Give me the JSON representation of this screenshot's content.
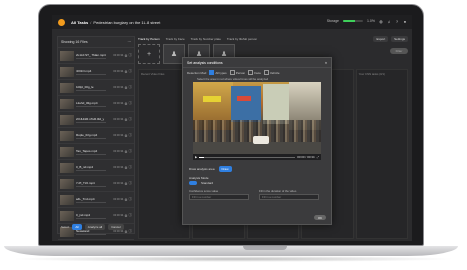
{
  "topbar": {
    "breadcrumb_root": "All Tasks",
    "breadcrumb_sep": "/",
    "task_title": "Pedestrian burglary on the 1L.8 street",
    "storage_label": "Storage",
    "storage_used": "1.0%",
    "storage_fraction": 0.6,
    "right_icons": [
      "globe-icon",
      "bell-icon",
      "help-icon",
      "user-icon"
    ]
  },
  "sidebar": {
    "header": "Showing 16 Files",
    "items": [
      {
        "name": "2L1L0.ST_ 7fdan.mp4",
        "meta": "00:00:34"
      },
      {
        "name": "4Ol1O.mp4",
        "meta": "00:00:34"
      },
      {
        "name": "1i0lpl_0tlg_le",
        "meta": "00:00:34"
      },
      {
        "name": "L2ehd_0tlg.mp4",
        "meta": "00:00:34"
      },
      {
        "name": "2OJHt1R.nTeR.0ld_y",
        "meta": "00:00:34"
      },
      {
        "name": "Ruple_0rlg.mp4",
        "meta": "00:00:34"
      },
      {
        "name": "Tan_Tapos.mp4",
        "meta": "00:00:34"
      },
      {
        "name": "0_B_nd.mp4",
        "meta": "00:00:34"
      },
      {
        "name": "7-Pl_Tz0.mp4",
        "meta": "00:00:34"
      },
      {
        "name": "a4L_Tnd.mp4",
        "meta": "00:00:34"
      },
      {
        "name": "0_jnd.mp4",
        "meta": "00:00:34"
      },
      {
        "name": "Neweland",
        "meta": "00:00:34"
      }
    ],
    "footer": {
      "select_label": "Select",
      "all_label": "All",
      "analyze_label": "Analyze all",
      "cancel_label": "Cancel"
    }
  },
  "main": {
    "tabs": [
      "Track by Person",
      "Track by Face",
      "Track by Number plate",
      "Track by lifeSki person"
    ],
    "export_label": "Export",
    "settings_label": "Settings",
    "analyze_label": "Filter",
    "columns": [
      "Recent Video Files",
      "",
      "",
      "",
      "Your CNN tasks (0/1)"
    ]
  },
  "modal": {
    "title": "Set analysis conditions",
    "close": "×",
    "filter_label": "Detection Mod",
    "filters": [
      {
        "label": "All types",
        "checked": true
      },
      {
        "label": "Person",
        "checked": false
      },
      {
        "label": "Face",
        "checked": false
      },
      {
        "label": "Vehicle",
        "checked": false
      }
    ],
    "subtitle": "Select the area in red where video/zones will be analyzed",
    "video_time": "00:00 / 00:34",
    "video_progress": 0.05,
    "draw_label": "Draw analysis area",
    "draw_button": "Draw",
    "analysis_mode_label": "Analysis Mode",
    "analysis_mode_value": "Standard",
    "confidence_label": "Confidence score value",
    "confidence_placeholder": "Fill in a number",
    "duration_label": "Fill in the duration of the video",
    "duration_placeholder": "Fill in a number",
    "ok_label": "OK"
  }
}
